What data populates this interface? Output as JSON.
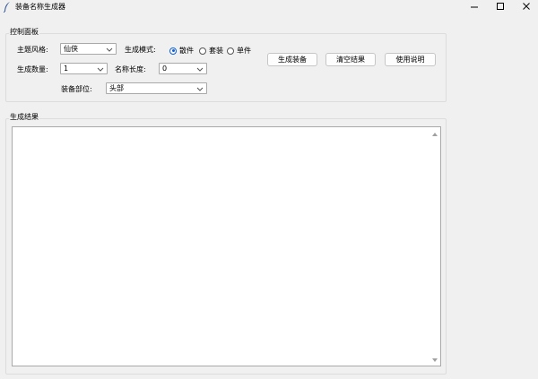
{
  "window": {
    "title": "装备名称生成器",
    "icon": "feather-icon",
    "controls": [
      "minimize-icon",
      "maximize-icon",
      "close-icon"
    ]
  },
  "control_panel": {
    "title": "控制面板",
    "theme": {
      "label": "主题风格:",
      "value": "仙侠"
    },
    "count": {
      "label": "生成数量:",
      "value": "1"
    },
    "name_length": {
      "label": "名称长度:",
      "value": "0"
    },
    "part": {
      "label": "装备部位:",
      "value": "头部"
    },
    "mode": {
      "label": "生成模式:",
      "options": [
        {
          "label": "散件",
          "checked": true
        },
        {
          "label": "套装",
          "checked": false
        },
        {
          "label": "单件",
          "checked": false
        }
      ]
    },
    "buttons": {
      "generate": "生成装备",
      "clear": "清空结果",
      "help": "使用说明"
    }
  },
  "results": {
    "title": "生成结果",
    "content": ""
  },
  "colors": {
    "background": "#f0f0f0",
    "accent": "#0b5ed7",
    "border": "#a9a9a9"
  }
}
